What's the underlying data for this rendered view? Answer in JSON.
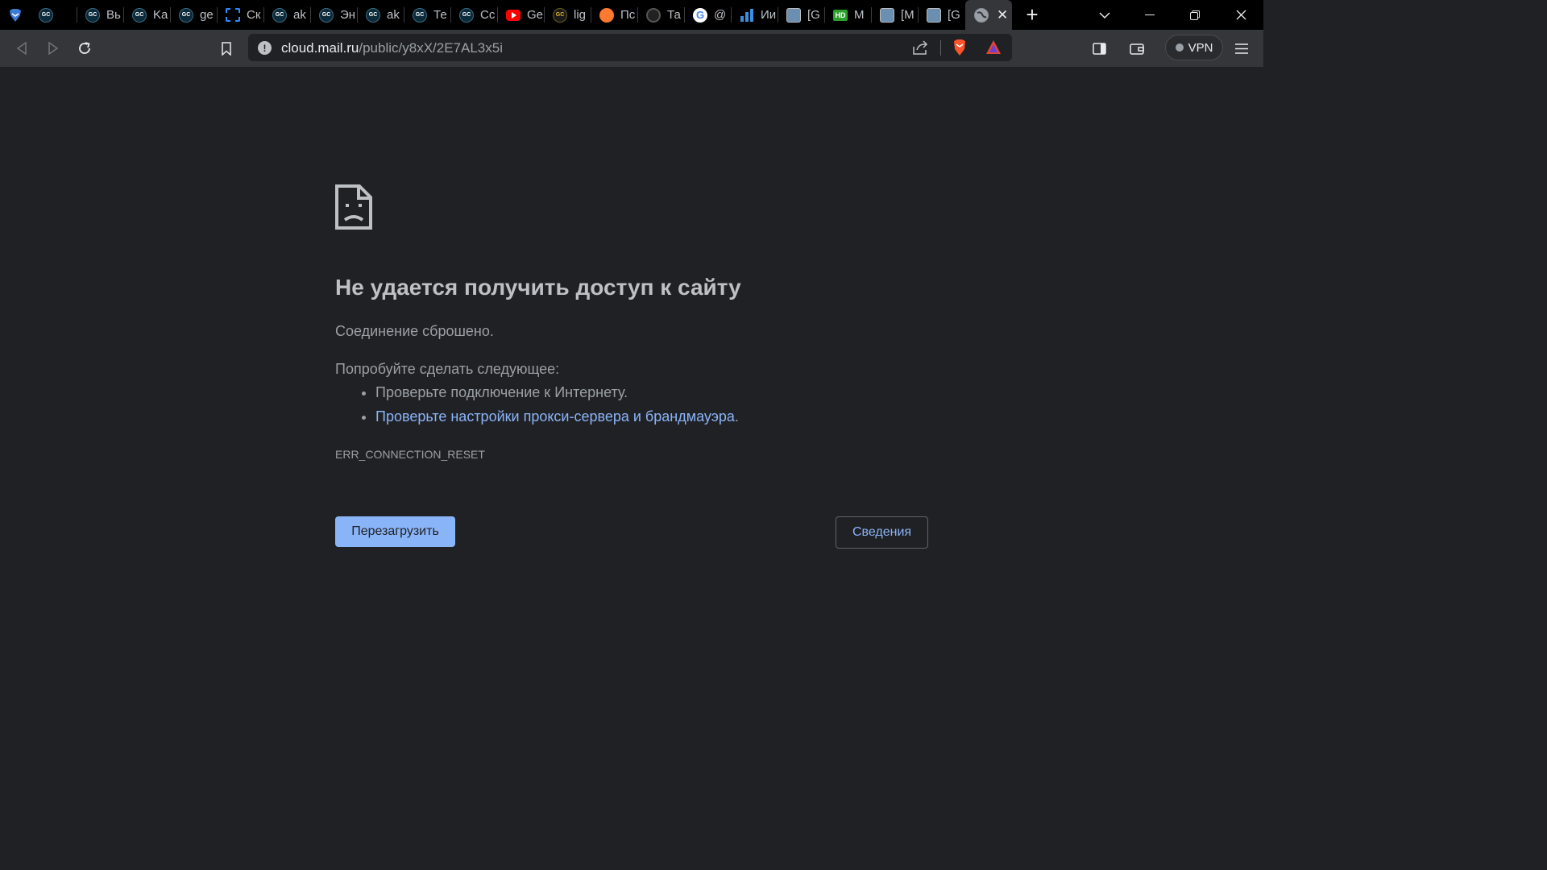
{
  "tabs": [
    {
      "favicon": "gc-icon",
      "title": ""
    },
    {
      "favicon": "gc-icon",
      "title": "Вь"
    },
    {
      "favicon": "gc-icon",
      "title": "Ka"
    },
    {
      "favicon": "gc-icon",
      "title": "ge"
    },
    {
      "favicon": "screenshot-select-icon",
      "title": "Ск"
    },
    {
      "favicon": "gc-icon",
      "title": "ak"
    },
    {
      "favicon": "gc-icon",
      "title": "Эн"
    },
    {
      "favicon": "gc-icon",
      "title": "ak"
    },
    {
      "favicon": "gc-icon",
      "title": "Те"
    },
    {
      "favicon": "gc-icon",
      "title": "Сс"
    },
    {
      "favicon": "youtube-icon",
      "title": "Ge"
    },
    {
      "favicon": "gc-gold-icon",
      "title": "lig"
    },
    {
      "favicon": "fire-icon",
      "title": "Пс"
    },
    {
      "favicon": "dark-circle-icon",
      "title": "Та"
    },
    {
      "favicon": "google-icon",
      "title": "@"
    },
    {
      "favicon": "chart-icon",
      "title": "Ии"
    },
    {
      "favicon": "cat-avatar-icon",
      "title": "[G"
    },
    {
      "favicon": "hd-icon",
      "title": "M"
    },
    {
      "favicon": "cat-avatar-icon",
      "title": "[M"
    },
    {
      "favicon": "cat-avatar-icon",
      "title": "[G"
    }
  ],
  "active_tab": {
    "favicon": "globe-icon",
    "close": "✕"
  },
  "new_tab_label": "+",
  "window_controls": {
    "tab_search": "⌵",
    "minimize": "—",
    "restore": "❐",
    "close": "✕"
  },
  "address_bar": {
    "host": "cloud.mail.ru",
    "path": "/public/y8xX/2E7AL3x5i"
  },
  "vpn_label": "VPN",
  "error": {
    "title": "Не удается получить доступ к сайту",
    "subtitle": "Соединение сброшено.",
    "try_label": "Попробуйте сделать следующее:",
    "suggestion_1": "Проверьте подключение к Интернету.",
    "suggestion_2_link": "Проверьте настройки прокси-сервера и брандмауэра",
    "suggestion_2_tail": ".",
    "code": "ERR_CONNECTION_RESET",
    "reload_button": "Перезагрузить",
    "details_button": "Сведения"
  },
  "colors": {
    "page_bg": "#202124",
    "toolbar_bg": "#35363a",
    "tabstrip_bg": "#000000",
    "accent": "#8ab4f8",
    "text_primary": "#bdc1c6",
    "text_secondary": "#9aa0a6"
  }
}
